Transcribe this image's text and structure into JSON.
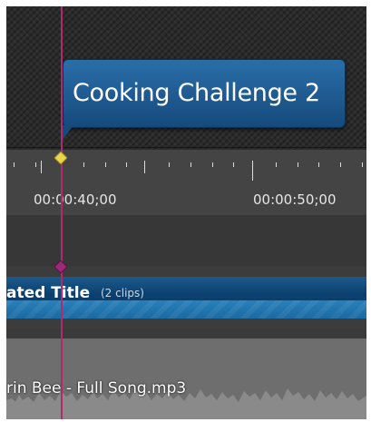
{
  "marker": {
    "label": "Cooking Challenge 2"
  },
  "ruler": {
    "timecodes": [
      "00:00:40;00",
      "00:00:50;00"
    ]
  },
  "tracks": [
    {
      "clip_title": "ated Title",
      "clip_count": "(2 clips)"
    },
    {
      "clip_title": "rin Bee - Full Song.mp3"
    }
  ],
  "colors": {
    "playhead": "#b02a6e",
    "marker_diamond": "#e8d44d",
    "callout": "#1c5a8c",
    "clip_blue": "#0b3f6d",
    "audio_clip": "#6e6e6e"
  },
  "icons": {
    "playhead_top": "diamond-icon",
    "playhead_track": "diamond-icon"
  }
}
